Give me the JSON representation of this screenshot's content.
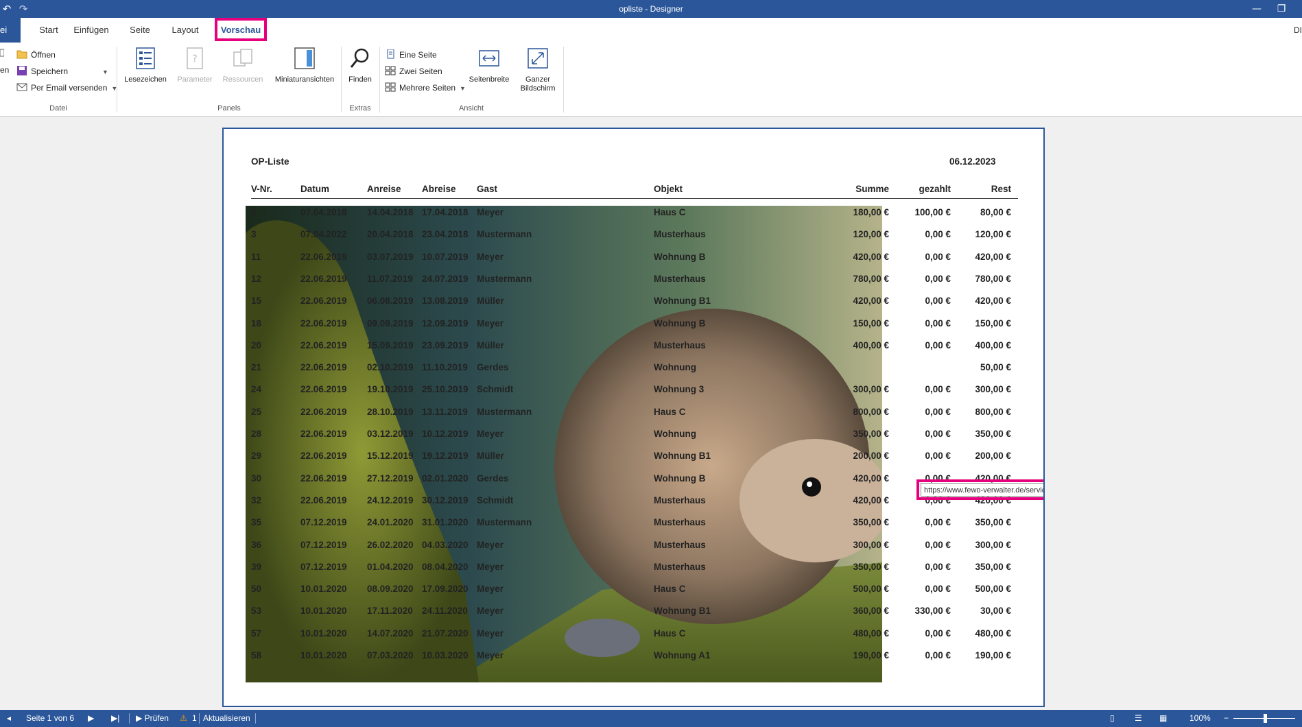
{
  "window": {
    "title": "opliste - Designer"
  },
  "tabs": [
    "ei",
    "Start",
    "Einfügen",
    "Seite",
    "Layout",
    "Vorschau"
  ],
  "tab_right_label": "DI",
  "ribbon": {
    "datei": {
      "label": "Datei",
      "open": "Öffnen",
      "save": "Speichern",
      "email": "Per Email versenden",
      "cut_text": "en"
    },
    "panels": {
      "label": "Panels",
      "bookmarks": "Lesezeichen",
      "params": "Parameter",
      "resources": "Ressourcen",
      "thumbs": "Miniaturansichten"
    },
    "extras": {
      "label": "Extras",
      "find": "Finden"
    },
    "ansicht": {
      "label": "Ansicht",
      "one_page": "Eine Seite",
      "two_pages": "Zwei Seiten",
      "more_pages": "Mehrere Seiten",
      "page_width": "Seitenbreite",
      "fullscreen_line1": "Ganzer",
      "fullscreen_line2": "Bildschirm"
    }
  },
  "report": {
    "title": "OP-Liste",
    "date": "06.12.2023",
    "headers": {
      "vnr": "V-Nr.",
      "datum": "Datum",
      "anreise": "Anreise",
      "abreise": "Abreise",
      "gast": "Gast",
      "objekt": "Objekt",
      "summe": "Summe",
      "gezahlt": "gezahlt",
      "rest": "Rest"
    },
    "rows": [
      [
        "2",
        "07.04.2018",
        "14.04.2018",
        "17.04.2018",
        "Meyer",
        "Haus C",
        "180,00 €",
        "100,00 €",
        "80,00 €"
      ],
      [
        "3",
        "07.04.2022",
        "20.04.2018",
        "23.04.2018",
        "Mustermann",
        "Musterhaus",
        "120,00 €",
        "0,00 €",
        "120,00 €"
      ],
      [
        "11",
        "22.06.2019",
        "03.07.2019",
        "10.07.2019",
        "Meyer",
        "Wohnung B",
        "420,00 €",
        "0,00 €",
        "420,00 €"
      ],
      [
        "12",
        "22.06.2019",
        "11.07.2019",
        "24.07.2019",
        "Mustermann",
        "Musterhaus",
        "780,00 €",
        "0,00 €",
        "780,00 €"
      ],
      [
        "15",
        "22.06.2019",
        "06.08.2019",
        "13.08.2019",
        "Müller",
        "Wohnung B1",
        "420,00 €",
        "0,00 €",
        "420,00 €"
      ],
      [
        "18",
        "22.06.2019",
        "09.09.2019",
        "12.09.2019",
        "Meyer",
        "Wohnung B",
        "150,00 €",
        "0,00 €",
        "150,00 €"
      ],
      [
        "20",
        "22.06.2019",
        "15.09.2019",
        "23.09.2019",
        "Müller",
        "Musterhaus",
        "400,00 €",
        "0,00 €",
        "400,00 €"
      ],
      [
        "21",
        "22.06.2019",
        "02.10.2019",
        "11.10.2019",
        "Gerdes",
        "Wohnung",
        "",
        "",
        "50,00 €"
      ],
      [
        "24",
        "22.06.2019",
        "19.10.2019",
        "25.10.2019",
        "Schmidt",
        "Wohnung 3",
        "300,00 €",
        "0,00 €",
        "300,00 €"
      ],
      [
        "25",
        "22.06.2019",
        "28.10.2019",
        "13.11.2019",
        "Mustermann",
        "Haus C",
        "800,00 €",
        "0,00 €",
        "800,00 €"
      ],
      [
        "28",
        "22.06.2019",
        "03.12.2019",
        "10.12.2019",
        "Meyer",
        "Wohnung",
        "350,00 €",
        "0,00 €",
        "350,00 €"
      ],
      [
        "29",
        "22.06.2019",
        "15.12.2019",
        "19.12.2019",
        "Müller",
        "Wohnung B1",
        "200,00 €",
        "0,00 €",
        "200,00 €"
      ],
      [
        "30",
        "22.06.2019",
        "27.12.2019",
        "02.01.2020",
        "Gerdes",
        "Wohnung B",
        "420,00 €",
        "0,00 €",
        "420,00 €"
      ],
      [
        "32",
        "22.06.2019",
        "24.12.2019",
        "30.12.2019",
        "Schmidt",
        "Musterhaus",
        "420,00 €",
        "0,00 €",
        "420,00 €"
      ],
      [
        "35",
        "07.12.2019",
        "24.01.2020",
        "31.01.2020",
        "Mustermann",
        "Musterhaus",
        "350,00 €",
        "0,00 €",
        "350,00 €"
      ],
      [
        "36",
        "07.12.2019",
        "26.02.2020",
        "04.03.2020",
        "Meyer",
        "Musterhaus",
        "300,00 €",
        "0,00 €",
        "300,00 €"
      ],
      [
        "39",
        "07.12.2019",
        "01.04.2020",
        "08.04.2020",
        "Meyer",
        "Musterhaus",
        "350,00 €",
        "0,00 €",
        "350,00 €"
      ],
      [
        "50",
        "10.01.2020",
        "08.09.2020",
        "17.09.2020",
        "Meyer",
        "Haus C",
        "500,00 €",
        "0,00 €",
        "500,00 €"
      ],
      [
        "53",
        "10.01.2020",
        "17.11.2020",
        "24.11.2020",
        "Meyer",
        "Wohnung B1",
        "360,00 €",
        "330,00 €",
        "30,00 €"
      ],
      [
        "57",
        "10.01.2020",
        "14.07.2020",
        "21.07.2020",
        "Meyer",
        "Haus C",
        "480,00 €",
        "0,00 €",
        "480,00 €"
      ],
      [
        "58",
        "10.01.2020",
        "07.03.2020",
        "10.03.2020",
        "Meyer",
        "Wohnung A1",
        "190,00 €",
        "0,00 €",
        "190,00 €"
      ]
    ]
  },
  "tooltip": {
    "url": "https://www.fewo-verwalter.de/service/schnittstellen-beschreibung.html"
  },
  "status": {
    "page": "Seite 1 von 6",
    "check": "Prüfen",
    "warn_count": "1",
    "update": "Aktualisieren",
    "zoom": "100%"
  },
  "colors": {
    "accent": "#2b579a",
    "highlight": "#e6007e"
  }
}
